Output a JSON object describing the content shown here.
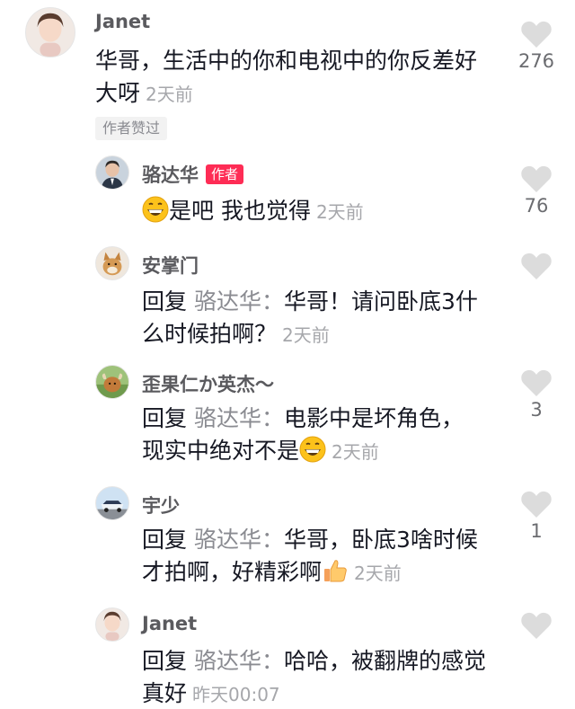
{
  "colors": {
    "author_tag": "#fe2c55",
    "heart": "#dcdcdc",
    "secondary_text": "#a6a7ab",
    "reply_name": "#8a8b91"
  },
  "comments": [
    {
      "username": "Janet",
      "text": "华哥，生活中的你和电视中的你反差好大呀",
      "time": "2天前",
      "badge": "作者赞过",
      "likes": "276"
    },
    {
      "username": "骆达华",
      "author_tag": "作者",
      "emoji": "grinning-face-emoji",
      "text": "是吧 我也觉得",
      "time": "2天前",
      "likes": "76"
    },
    {
      "username": "安掌门",
      "reply_prefix": "回复",
      "reply_to": "骆达华：",
      "text": "华哥！请问卧底3什么时候拍啊？",
      "time": "2天前",
      "likes": ""
    },
    {
      "username": "歪果仁か英杰～",
      "reply_prefix": "回复",
      "reply_to": "骆达华：",
      "text": "电影中是坏角色，现实中绝对不是",
      "emoji": "grinning-face-emoji",
      "time": "2天前",
      "likes": "3"
    },
    {
      "username": "宇少",
      "reply_prefix": "回复",
      "reply_to": "骆达华：",
      "text": "华哥，卧底3啥时候才拍啊，好精彩啊",
      "emoji": "thumbs-up-emoji",
      "time": "2天前",
      "likes": "1"
    },
    {
      "username": "Janet",
      "reply_prefix": "回复",
      "reply_to": "骆达华：",
      "text": "哈哈，被翻牌的感觉真好",
      "time": "昨天00:07",
      "likes": ""
    }
  ]
}
